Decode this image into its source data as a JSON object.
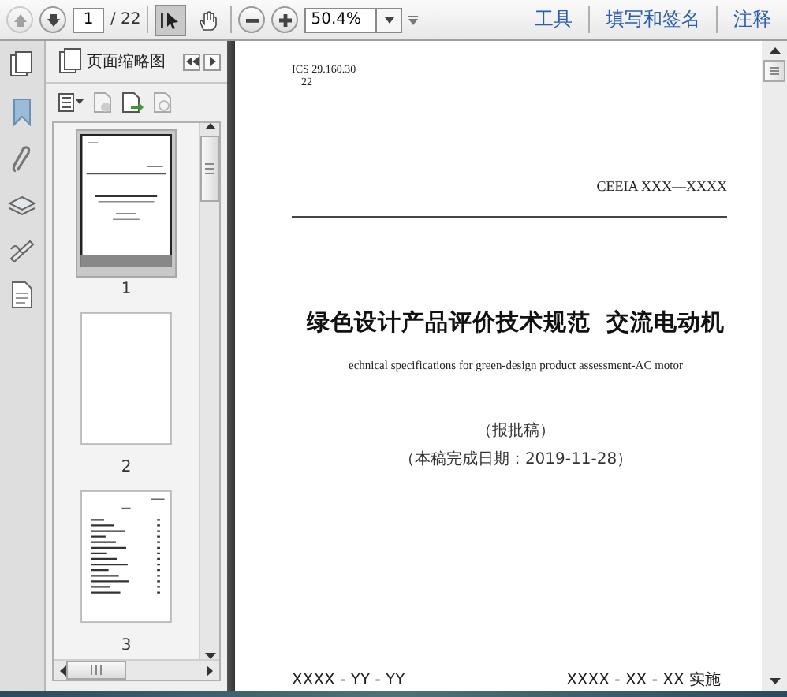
{
  "toolbar": {
    "nav_buttons": [
      {
        "kind": "up",
        "disabled": true
      },
      {
        "kind": "down",
        "disabled": false
      }
    ],
    "page_field": {
      "value": "1"
    },
    "page_count": "/ 22",
    "tools": [
      {
        "kind": "select",
        "selected": true
      },
      {
        "kind": "hand",
        "selected": false
      }
    ],
    "zoom_field": {
      "value": "50.4%"
    },
    "menu_links": [
      "工具",
      "填写和签名",
      "注释"
    ]
  },
  "sidebar": {
    "panel_title": "页面缩略图",
    "thumbnails": [
      {
        "label": "1",
        "kind": "cover",
        "selected": true
      },
      {
        "label": "2",
        "kind": "blank",
        "selected": false
      },
      {
        "label": "3",
        "kind": "contents",
        "selected": false
      }
    ]
  },
  "document": {
    "ics": "ICS 29.160.30",
    "code": "22",
    "standard_number": "CEEIA XXX—XXXX",
    "title": "绿色设计产品评价技术规范  交流电动机",
    "subtitle": "echnical specifications for green-design product assessment-AC motor",
    "draft_label": "（报批稿）",
    "completion_date": "（本稿完成日期：2019-11-28）",
    "issue_date": "XXXX - YY - YY",
    "effective_date": "XXXX - XX - XX 实施"
  }
}
